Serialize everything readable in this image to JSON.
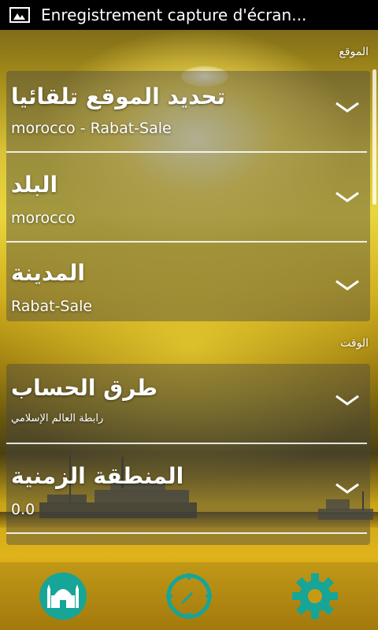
{
  "statusbar": {
    "title": "Enregistrement capture d'écran..."
  },
  "sections": {
    "location_header": "الموقع",
    "time_header": "الوقت"
  },
  "location": {
    "auto_title": "تحديد الموقع تلقائيا",
    "auto_value": "morocco - Rabat-Sale",
    "country_title": "البلد",
    "country_value": "morocco",
    "city_title": "المدينة",
    "city_value": "Rabat-Sale"
  },
  "time": {
    "method_title": "طرق الحساب",
    "method_value": "رابطة العالم الإسلامي",
    "timezone_title": "المنطقة الزمنية",
    "timezone_value": "0.0"
  },
  "colors": {
    "accent_teal": "#1aa69a",
    "icon_teal": "#16a597"
  },
  "icons": [
    "image-icon",
    "chevron-down-icon",
    "mosque-icon",
    "compass-icon",
    "gear-icon"
  ]
}
